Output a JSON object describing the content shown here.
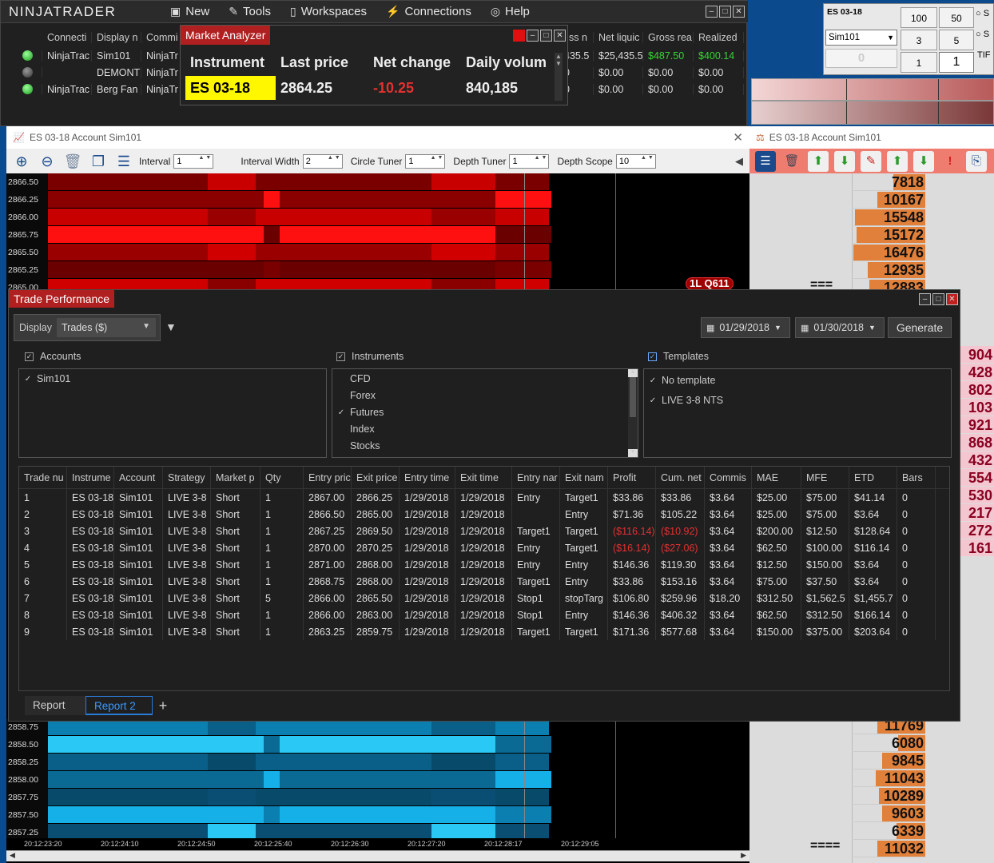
{
  "app": {
    "logo": "NINJATRADER"
  },
  "menu": [
    {
      "icon": "new-icon",
      "glyph": "▣",
      "label": "New"
    },
    {
      "icon": "tools-icon",
      "glyph": "✎",
      "label": "Tools"
    },
    {
      "icon": "workspaces-icon",
      "glyph": "▯",
      "label": "Workspaces"
    },
    {
      "icon": "connections-icon",
      "glyph": "⚡",
      "label": "Connections"
    },
    {
      "icon": "help-icon",
      "glyph": "◎",
      "label": "Help"
    }
  ],
  "accounts_grid": {
    "headers": [
      "Connecti",
      "Display n",
      "Commi",
      "ss n",
      "Net liquic",
      "Gross rea",
      "Realized"
    ],
    "rows": [
      {
        "status": "green",
        "conn": "NinjaTrac",
        "name": "Sim101",
        "comm": "NinjaTr",
        "ss": "435.5",
        "netliq": "$25,435.5",
        "gross": "$487.50",
        "realized": "$400.14",
        "positive": true
      },
      {
        "status": "gray",
        "conn": "",
        "name": "DEMONT",
        "comm": "NinjaTr",
        "ss": "0",
        "netliq": "$0.00",
        "gross": "$0.00",
        "realized": "$0.00",
        "positive": false
      },
      {
        "status": "green",
        "conn": "NinjaTrac",
        "name": "Berg Fan",
        "comm": "NinjaTr",
        "ss": "0",
        "netliq": "$0.00",
        "gross": "$0.00",
        "realized": "$0.00",
        "positive": false
      }
    ]
  },
  "market_analyzer": {
    "title": "Market Analyzer",
    "headers": [
      "Instrument",
      "Last price",
      "Net change",
      "Daily volum"
    ],
    "row": {
      "instrument": "ES 03-18",
      "last": "2864.25",
      "change": "-10.25",
      "volume": "840,185"
    }
  },
  "order_entry": {
    "instrument": "ES 03-18",
    "account": "Sim101",
    "quantity_display": "0",
    "qty_buttons": [
      "100",
      "50",
      "3",
      "5",
      "1"
    ],
    "quantity": "1",
    "tif_label": "TIF",
    "radio_labels": [
      "S",
      "S"
    ]
  },
  "chart": {
    "title": "ES 03-18  Account Sim101",
    "params": [
      {
        "label": "Interval",
        "value": "1"
      },
      {
        "label": "Interval Width",
        "value": "2"
      },
      {
        "label": "Circle Tuner",
        "value": "1"
      },
      {
        "label": "Depth Tuner",
        "value": "1"
      },
      {
        "label": "Depth Scope",
        "value": "10"
      }
    ],
    "top_prices": [
      "2866.50",
      "2866.25",
      "2866.00",
      "2865.75",
      "2865.50",
      "2865.25",
      "2865.00"
    ],
    "bottom_prices": [
      "2858.75",
      "2858.50",
      "2858.25",
      "2858.00",
      "2857.75",
      "2857.50",
      "2857.25"
    ],
    "time_labels": [
      "20:12:23:20",
      "20:12:24:10",
      "20:12:24:50",
      "20:12:25:40",
      "20:12:26:30",
      "20:12:27:20",
      "20:12:28:17",
      "20:12:29:05"
    ],
    "badge": "1L Q611",
    "colors": {
      "bid_heat": "#c00000",
      "ask_heat": "#00a8e0"
    }
  },
  "dom": {
    "title": "ES 03-18  Account Sim101",
    "top_volumes": [
      "7818",
      "10167",
      "15548",
      "15172",
      "16476",
      "12935",
      "12883"
    ],
    "right_volumes": [
      "904",
      "428",
      "802",
      "103",
      "921",
      "868",
      "432",
      "554",
      "530",
      "217",
      "272",
      "161"
    ],
    "bottom_volumes": [
      "11769",
      "6080",
      "9845",
      "11043",
      "10289",
      "9603",
      "6339",
      "11032"
    ],
    "marker": "===",
    "marker_bottom": "===="
  },
  "trade_performance": {
    "title": "Trade Performance",
    "display_label": "Display",
    "display_value": "Trades ($)",
    "date_from": "01/29/2018",
    "date_to": "01/30/2018",
    "generate": "Generate",
    "accounts_label": "Accounts",
    "instruments_label": "Instruments",
    "templates_label": "Templates",
    "accounts": [
      "Sim101"
    ],
    "instruments": [
      {
        "name": "CFD",
        "checked": false
      },
      {
        "name": "Forex",
        "checked": false
      },
      {
        "name": "Futures",
        "checked": true
      },
      {
        "name": "Index",
        "checked": false
      },
      {
        "name": "Stocks",
        "checked": false
      }
    ],
    "templates": [
      "No template",
      "LIVE 3-8 NTS"
    ],
    "columns": [
      "Trade nu",
      "Instrume",
      "Account",
      "Strategy",
      "Market p",
      "Qty",
      "Entry pric",
      "Exit price",
      "Entry time",
      "Exit time",
      "Entry nar",
      "Exit nam",
      "Profit",
      "Cum. net",
      "Commis",
      "MAE",
      "MFE",
      "ETD",
      "Bars"
    ],
    "trades": [
      [
        "1",
        "ES 03-18",
        "Sim101",
        "LIVE 3-8",
        "Short",
        "1",
        "2867.00",
        "2866.25",
        "1/29/2018",
        "1/29/2018",
        "Entry",
        "Target1",
        "$33.86",
        "$33.86",
        "$3.64",
        "$25.00",
        "$75.00",
        "$41.14",
        "0"
      ],
      [
        "2",
        "ES 03-18",
        "Sim101",
        "LIVE 3-8",
        "Short",
        "1",
        "2866.50",
        "2865.00",
        "1/29/2018",
        "1/29/2018",
        "",
        "Entry",
        "$71.36",
        "$105.22",
        "$3.64",
        "$25.00",
        "$75.00",
        "$3.64",
        "0"
      ],
      [
        "3",
        "ES 03-18",
        "Sim101",
        "LIVE 3-8",
        "Short",
        "1",
        "2867.25",
        "2869.50",
        "1/29/2018",
        "1/29/2018",
        "Target1",
        "Target1",
        "($116.14)",
        "($10.92)",
        "$3.64",
        "$200.00",
        "$12.50",
        "$128.64",
        "0"
      ],
      [
        "4",
        "ES 03-18",
        "Sim101",
        "LIVE 3-8",
        "Short",
        "1",
        "2870.00",
        "2870.25",
        "1/29/2018",
        "1/29/2018",
        "Entry",
        "Target1",
        "($16.14)",
        "($27.06)",
        "$3.64",
        "$62.50",
        "$100.00",
        "$116.14",
        "0"
      ],
      [
        "5",
        "ES 03-18",
        "Sim101",
        "LIVE 3-8",
        "Short",
        "1",
        "2871.00",
        "2868.00",
        "1/29/2018",
        "1/29/2018",
        "Entry",
        "Entry",
        "$146.36",
        "$119.30",
        "$3.64",
        "$12.50",
        "$150.00",
        "$3.64",
        "0"
      ],
      [
        "6",
        "ES 03-18",
        "Sim101",
        "LIVE 3-8",
        "Short",
        "1",
        "2868.75",
        "2868.00",
        "1/29/2018",
        "1/29/2018",
        "Target1",
        "Entry",
        "$33.86",
        "$153.16",
        "$3.64",
        "$75.00",
        "$37.50",
        "$3.64",
        "0"
      ],
      [
        "7",
        "ES 03-18",
        "Sim101",
        "LIVE 3-8",
        "Short",
        "5",
        "2866.00",
        "2865.50",
        "1/29/2018",
        "1/29/2018",
        "Stop1",
        "stopTarg",
        "$106.80",
        "$259.96",
        "$18.20",
        "$312.50",
        "$1,562.5",
        "$1,455.7",
        "0"
      ],
      [
        "8",
        "ES 03-18",
        "Sim101",
        "LIVE 3-8",
        "Short",
        "1",
        "2866.00",
        "2863.00",
        "1/29/2018",
        "1/29/2018",
        "Stop1",
        "Entry",
        "$146.36",
        "$406.32",
        "$3.64",
        "$62.50",
        "$312.50",
        "$166.14",
        "0"
      ],
      [
        "9",
        "ES 03-18",
        "Sim101",
        "LIVE 3-8",
        "Short",
        "1",
        "2863.25",
        "2859.75",
        "1/29/2018",
        "1/29/2018",
        "Target1",
        "Target1",
        "$171.36",
        "$577.68",
        "$3.64",
        "$150.00",
        "$375.00",
        "$203.64",
        "0"
      ]
    ],
    "tabs": [
      "Report",
      "Report 2"
    ]
  }
}
